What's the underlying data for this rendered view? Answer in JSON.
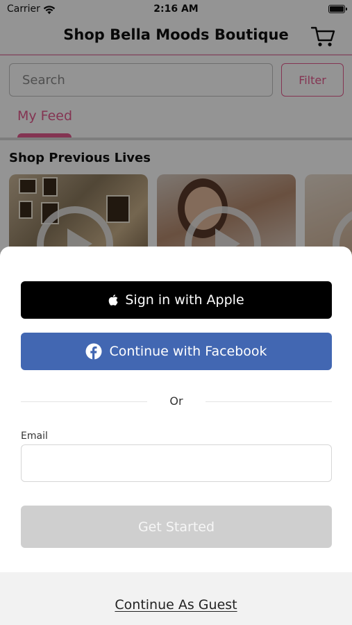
{
  "status_bar": {
    "carrier": "Carrier",
    "time": "2:16 AM"
  },
  "nav": {
    "title": "Shop Bella Moods Boutique",
    "cart_icon": "cart-icon"
  },
  "search": {
    "placeholder": "Search",
    "value": ""
  },
  "filter": {
    "label": "Filter"
  },
  "tabs": [
    {
      "label": "My Feed",
      "active": true
    }
  ],
  "section": {
    "title": "Shop Previous Lives"
  },
  "thumbnails": [
    {
      "icon": "play-icon"
    },
    {
      "icon": "play-icon"
    },
    {
      "icon": "play-icon"
    }
  ],
  "colors": {
    "accent": "#e35a8d",
    "facebook": "#4267b2",
    "apple": "#000000",
    "disabled": "#cfcfcf"
  },
  "sheet": {
    "apple_button": "Sign in with Apple",
    "facebook_button": "Continue with Facebook",
    "or_text": "Or",
    "email_label": "Email",
    "email_value": "",
    "start_button": "Get Started",
    "guest_link": "Continue As Guest"
  }
}
